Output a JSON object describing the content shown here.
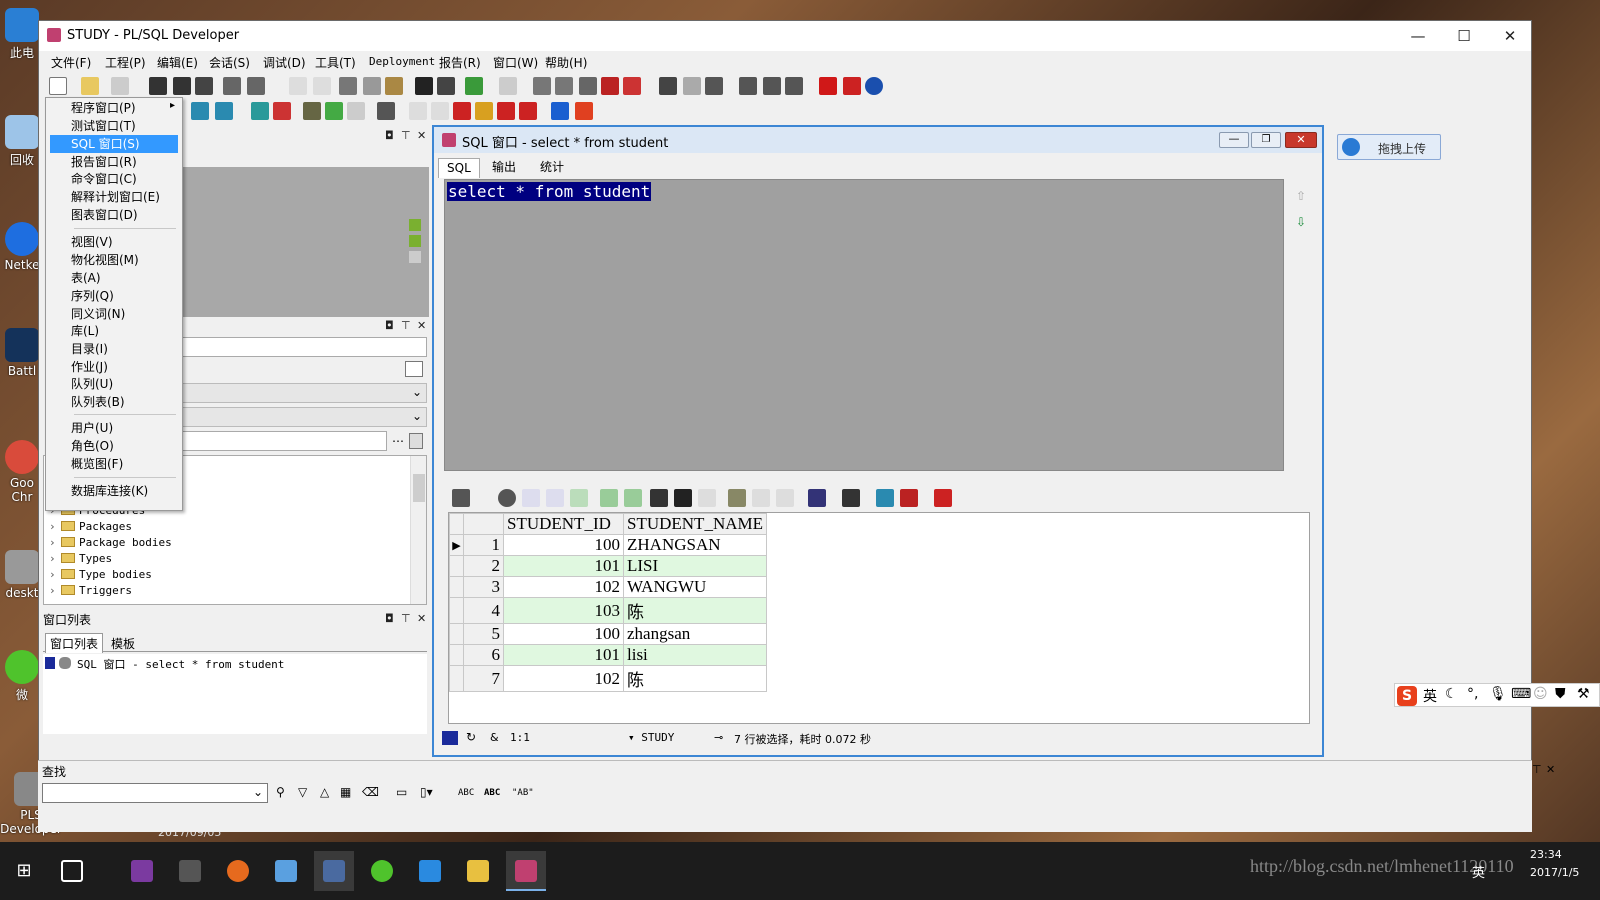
{
  "app": {
    "title": "STUDY - PL/SQL Developer",
    "window_controls": {
      "minimize": "—",
      "maximize": "☐",
      "close": "✕"
    }
  },
  "menu": [
    "文件(F)",
    "工程(P)",
    "编辑(E)",
    "会话(S)",
    "调试(D)",
    "工具(T)",
    "Deployment",
    "报告(R)",
    "窗口(W)",
    "帮助(H)"
  ],
  "new_menu": {
    "group1": [
      "程序窗口(P)",
      "测试窗口(T)",
      "SQL 窗口(S)",
      "报告窗口(R)",
      "命令窗口(C)",
      "解释计划窗口(E)",
      "图表窗口(D)"
    ],
    "group2": [
      "视图(V)",
      "物化视图(M)",
      "表(A)",
      "序列(Q)",
      "同义词(N)",
      "库(L)",
      "目录(I)",
      "作业(J)",
      "队列(U)",
      "队列表(B)"
    ],
    "group3": [
      "用户(U)",
      "角色(O)",
      "概览图(F)"
    ],
    "group4": [
      "数据库连接(K)"
    ],
    "selected": "SQL 窗口(S)"
  },
  "object_tree": {
    "items": [
      "Procedures",
      "Packages",
      "Package bodies",
      "Types",
      "Type bodies",
      "Triggers"
    ]
  },
  "window_list": {
    "header": "窗口列表",
    "tabs": [
      "窗口列表",
      "模板"
    ],
    "entries": [
      "SQL 窗口 - select * from student"
    ]
  },
  "sql_window": {
    "title": "SQL 窗口 - select * from student",
    "tabs": [
      "SQL",
      "输出",
      "统计"
    ],
    "query": "select * from student",
    "columns": [
      "STUDENT_ID",
      "STUDENT_NAME"
    ],
    "rows": [
      {
        "n": "1",
        "id": "100",
        "name": "ZHANGSAN"
      },
      {
        "n": "2",
        "id": "101",
        "name": "LISI"
      },
      {
        "n": "3",
        "id": "102",
        "name": "WANGWU"
      },
      {
        "n": "4",
        "id": "103",
        "name": "陈"
      },
      {
        "n": "5",
        "id": "100",
        "name": "zhangsan"
      },
      {
        "n": "6",
        "id": "101",
        "name": "lisi"
      },
      {
        "n": "7",
        "id": "102",
        "name": "陈"
      }
    ],
    "status": {
      "position": "1:1",
      "connection": "STUDY",
      "message": "7 行被选择，耗时 0.072 秒"
    }
  },
  "find": {
    "label": "查找",
    "buttons": [
      "ABC",
      "ABC",
      "\"AB\""
    ]
  },
  "upload_button": "拖拽上传",
  "desktop_icons": [
    "此电",
    "回收",
    "Netke",
    "Battl",
    "Goo Chr",
    "deskt",
    "微",
    "PLS Developer"
  ],
  "desktop_caption": "2017/09/05",
  "ime": {
    "lang": "英"
  },
  "taskbar": {
    "time": "23:34",
    "date": "2017/1/5",
    "lang": "英",
    "watermark": "http://blog.csdn.net/lmhenet1120110"
  },
  "colors": {
    "selection": "#3399ff",
    "editor_bg": "#a0a0a0",
    "query_highlight": "#000080",
    "alt_row": "#e0f8e0",
    "sql_window_border": "#3c86d4"
  }
}
